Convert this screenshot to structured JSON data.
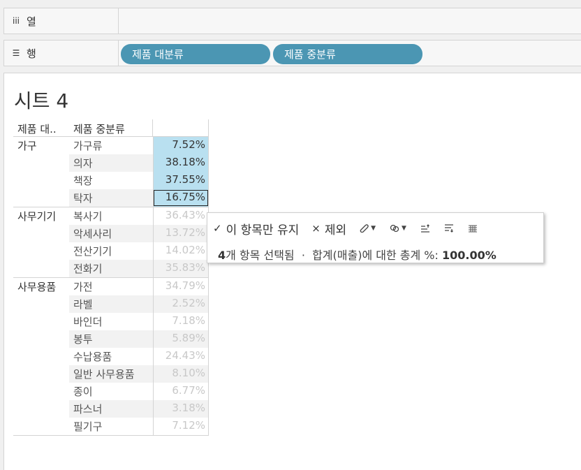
{
  "shelves": {
    "columns": {
      "label": "열",
      "icon": "iii"
    },
    "rows": {
      "label": "행",
      "icon": "☰",
      "pills": [
        "제품 대분류",
        "제품 중분류"
      ]
    }
  },
  "sheet": {
    "title": "시트 4"
  },
  "table": {
    "headers": {
      "category": "제품 대..",
      "subcategory": "제품 중분류"
    },
    "groups": [
      {
        "name": "가구",
        "rows": [
          {
            "sub": "가구류",
            "value": "7.52%",
            "state": "selected"
          },
          {
            "sub": "의자",
            "value": "38.18%",
            "state": "selected"
          },
          {
            "sub": "책장",
            "value": "37.55%",
            "state": "selected"
          },
          {
            "sub": "탁자",
            "value": "16.75%",
            "state": "focused"
          }
        ]
      },
      {
        "name": "사무기기",
        "rows": [
          {
            "sub": "복사기",
            "value": "36.43%",
            "state": "dim"
          },
          {
            "sub": "악세사리",
            "value": "13.72%",
            "state": "dim"
          },
          {
            "sub": "전산기기",
            "value": "14.02%",
            "state": "dim"
          },
          {
            "sub": "전화기",
            "value": "35.83%",
            "state": "dim"
          }
        ]
      },
      {
        "name": "사무용품",
        "rows": [
          {
            "sub": "가전",
            "value": "34.79%",
            "state": "dim"
          },
          {
            "sub": "라벨",
            "value": "2.52%",
            "state": "dim"
          },
          {
            "sub": "바인더",
            "value": "7.18%",
            "state": "dim"
          },
          {
            "sub": "봉투",
            "value": "5.89%",
            "state": "dim"
          },
          {
            "sub": "수납용품",
            "value": "24.43%",
            "state": "dim"
          },
          {
            "sub": "일반 사무용품",
            "value": "8.10%",
            "state": "dim"
          },
          {
            "sub": "종이",
            "value": "6.77%",
            "state": "dim"
          },
          {
            "sub": "파스너",
            "value": "3.18%",
            "state": "dim"
          },
          {
            "sub": "필기구",
            "value": "7.12%",
            "state": "dim"
          }
        ]
      }
    ]
  },
  "tooltip": {
    "keep_only": {
      "glyph": "✓",
      "label": "이 항목만 유지"
    },
    "exclude": {
      "glyph": "×",
      "label": "제외"
    },
    "icons": [
      "clip-icon",
      "group-icon",
      "sort-ascending-icon",
      "sort-descending-icon",
      "view-data-icon"
    ],
    "summary": {
      "count": "4",
      "count_suffix": "개 항목 선택됨",
      "separator": "·",
      "measure": "합계(매출)에 대한 총계 %:",
      "total": "100.00%"
    }
  },
  "colors": {
    "pill": "#4b96b3",
    "selection": "#b9e0f0",
    "dim_text": "#c8c8c8"
  }
}
